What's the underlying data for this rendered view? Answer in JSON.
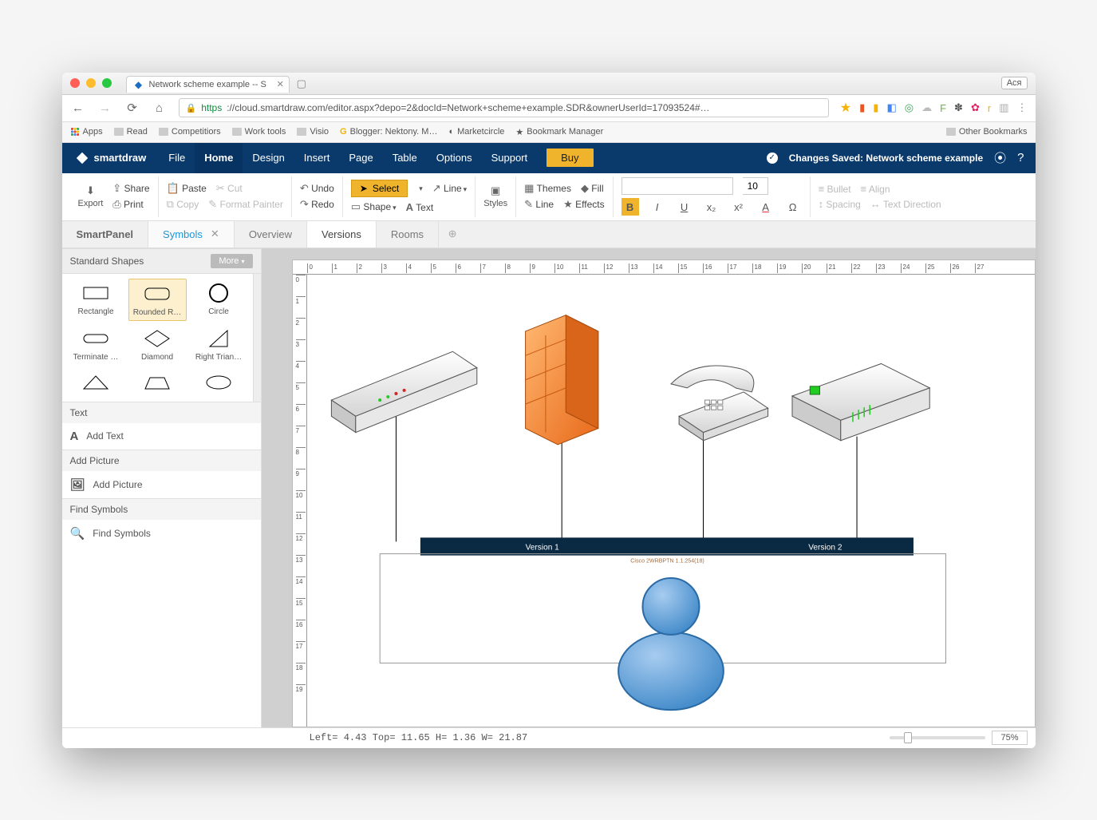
{
  "browser": {
    "tab_title": "Network scheme example -- S",
    "user_badge": "Ася",
    "url_https": "https",
    "url_rest": "://cloud.smartdraw.com/editor.aspx?depo=2&docId=Network+scheme+example.SDR&ownerUserId=17093524#…",
    "bookmarks": [
      "Apps",
      "Read",
      "Competitiors",
      "Work tools",
      "Visio",
      "Blogger: Nektony. M…",
      "Marketcircle",
      "Bookmark Manager"
    ],
    "bookmark_right": "Other Bookmarks"
  },
  "header": {
    "brand": "smartdraw",
    "menus": [
      "File",
      "Home",
      "Design",
      "Insert",
      "Page",
      "Table",
      "Options",
      "Support"
    ],
    "active_menu": 1,
    "buy": "Buy",
    "save_status": "Changes Saved: Network scheme example"
  },
  "ribbon": {
    "export": "Export",
    "share": "Share",
    "print": "Print",
    "paste": "Paste",
    "cut": "Cut",
    "copy": "Copy",
    "format_painter": "Format Painter",
    "undo": "Undo",
    "redo": "Redo",
    "select": "Select",
    "line": "Line",
    "shape": "Shape",
    "text_tool": "Text",
    "styles": "Styles",
    "themes": "Themes",
    "fill": "Fill",
    "line2": "Line",
    "effects": "Effects",
    "font_family": "",
    "font_size": "10",
    "bullet": "Bullet",
    "spacing": "Spacing",
    "align": "Align",
    "text_direction": "Text Direction"
  },
  "doc_tabs": [
    "SmartPanel",
    "Symbols",
    "Overview",
    "Versions",
    "Rooms"
  ],
  "smartpanel": {
    "shapes_header": "Standard Shapes",
    "more": "More",
    "shapes": [
      "Rectangle",
      "Rounded R…",
      "Circle",
      "Terminate …",
      "Diamond",
      "Right Trian…"
    ],
    "selected_shape": 1,
    "text_header": "Text",
    "add_text": "Add Text",
    "picture_header": "Add Picture",
    "add_picture": "Add Picture",
    "find_header": "Find Symbols",
    "find_symbols": "Find Symbols"
  },
  "canvas": {
    "h_ticks": [
      "0",
      "1",
      "2",
      "3",
      "4",
      "5",
      "6",
      "7",
      "8",
      "9",
      "10",
      "11",
      "12",
      "13",
      "14",
      "15",
      "16",
      "17",
      "18",
      "19",
      "20",
      "21",
      "22",
      "23",
      "24",
      "25",
      "26",
      "27"
    ],
    "v_ticks": [
      "0",
      "1",
      "2",
      "3",
      "4",
      "5",
      "6",
      "7",
      "8",
      "9",
      "10",
      "11",
      "12",
      "13",
      "14",
      "15",
      "16",
      "17",
      "18",
      "19"
    ],
    "version1": "Version 1",
    "version2": "Version 2",
    "cisco_label": "Cisco 2WRBPTN 1.1.254(18)"
  },
  "status": {
    "coords": "Left= 4.43 Top= 11.65 H= 1.36 W= 21.87",
    "zoom": "75%"
  }
}
